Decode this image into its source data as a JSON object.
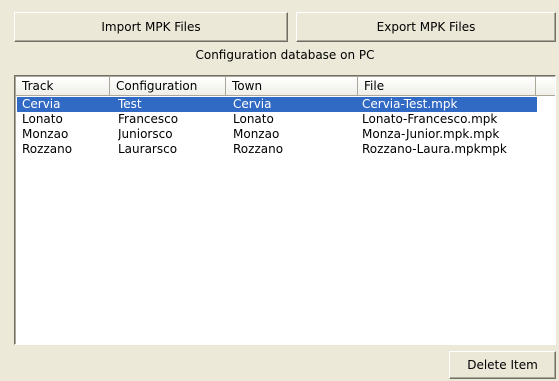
{
  "buttons": {
    "import_label": "Import MPK Files",
    "export_label": "Export MPK Files",
    "delete_label": "Delete Item"
  },
  "caption": "Configuration database on PC",
  "table": {
    "columns": [
      "Track",
      "Configuration",
      "Town",
      "File"
    ],
    "rows": [
      {
        "track": "Cervia",
        "configuration": "Test",
        "town": "Cervia",
        "file": "Cervia-Test.mpk",
        "selected": true
      },
      {
        "track": "Lonato",
        "configuration": "Francesco",
        "town": "Lonato",
        "file": "Lonato-Francesco.mpk",
        "selected": false
      },
      {
        "track": "Monzao",
        "configuration": "Juniorsco",
        "town": "Monzao",
        "file": "Monza-Junior.mpk.mpk",
        "selected": false
      },
      {
        "track": "Rozzano",
        "configuration": "Laurarsco",
        "town": "Rozzano",
        "file": "Rozzano-Laura.mpkmpk",
        "selected": false
      }
    ]
  },
  "colors": {
    "window_bg": "#ECE9D8",
    "selection": "#316AC5",
    "list_bg": "#FFFFFF"
  }
}
